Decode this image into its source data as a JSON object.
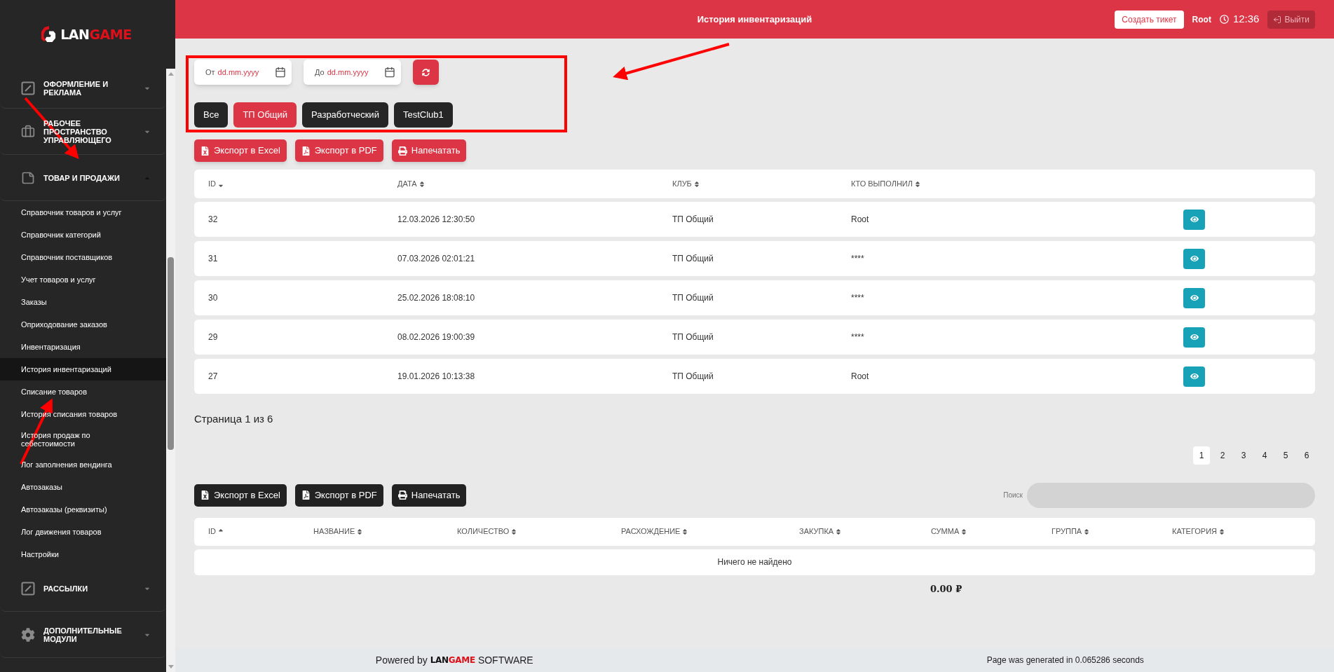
{
  "sidebar": {
    "logo": {
      "light": "LAN",
      "accent": "GAME"
    },
    "groups": [
      {
        "label": "ОФОРМЛЕНИЕ И РЕКЛАМА",
        "expanded": false
      },
      {
        "label": "РАБОЧЕЕ ПРОСТРАНСТВО УПРАВЛЯЮЩЕГО",
        "expanded": false
      },
      {
        "label": "ТОВАР И ПРОДАЖИ",
        "expanded": true,
        "children": [
          {
            "label": "Справочник товаров и услуг",
            "selected": false
          },
          {
            "label": "Справочник категорий",
            "selected": false
          },
          {
            "label": "Справочник поставщиков",
            "selected": false
          },
          {
            "label": "Учет товаров и услуг",
            "selected": false
          },
          {
            "label": "Заказы",
            "selected": false
          },
          {
            "label": "Оприходование заказов",
            "selected": false
          },
          {
            "label": "Инвентаризация",
            "selected": false
          },
          {
            "label": "История инвентаризаций",
            "selected": true
          },
          {
            "label": "Списание товаров",
            "selected": false
          },
          {
            "label": "История списания товаров",
            "selected": false
          },
          {
            "label": "История продаж по себестоимости",
            "selected": false
          },
          {
            "label": "Лог заполнения вендинга",
            "selected": false
          },
          {
            "label": "Автозаказы",
            "selected": false
          },
          {
            "label": "Автозаказы (реквизиты)",
            "selected": false
          },
          {
            "label": "Лог движения товаров",
            "selected": false
          },
          {
            "label": "Настройки",
            "selected": false
          }
        ]
      },
      {
        "label": "РАССЫЛКИ",
        "expanded": false
      },
      {
        "label": "ДОПОЛНИТЕЛЬНЫЕ МОДУЛИ",
        "expanded": false
      }
    ]
  },
  "header": {
    "title": "История инвентаризаций",
    "ticket_button": "Создать тикет",
    "user": "Root",
    "time": "12:36",
    "logout_button": "Выйти"
  },
  "filters": {
    "date_from": {
      "label": "От",
      "placeholder": "dd.mm.yyyy"
    },
    "date_to": {
      "label": "До",
      "placeholder": "dd.mm.yyyy"
    },
    "clubs": [
      {
        "label": "Все",
        "selected": false
      },
      {
        "label": "ТП Общий",
        "selected": true
      },
      {
        "label": "Разработческий",
        "selected": false
      },
      {
        "label": "TestClub1",
        "selected": false
      }
    ]
  },
  "export_buttons": [
    {
      "label": "Экспорт в Excel",
      "kind": "excel"
    },
    {
      "label": "Экспорт в PDF",
      "kind": "pdf"
    },
    {
      "label": "Напечатать",
      "kind": "print"
    }
  ],
  "history_table": {
    "sort_ascending": false,
    "columns": [
      {
        "label": "ID",
        "sorted": true
      },
      {
        "label": "ДАТА",
        "sorted": false
      },
      {
        "label": "КЛУБ",
        "sorted": false
      },
      {
        "label": "КТО ВЫПОЛНИЛ",
        "sorted": false
      }
    ],
    "rows": [
      [
        "32",
        "12.03.2026 12:30:50",
        "ТП Общий",
        "Root"
      ],
      [
        "31",
        "07.03.2026 02:01:21",
        "ТП Общий",
        "****"
      ],
      [
        "30",
        "25.02.2026 18:08:10",
        "ТП Общий",
        "****"
      ],
      [
        "29",
        "08.02.2026 19:00:39",
        "ТП Общий",
        "****"
      ],
      [
        "27",
        "19.01.2026 10:13:38",
        "ТП Общий",
        "Root"
      ]
    ]
  },
  "pagination": {
    "summary": "Страница 1 из 6",
    "pages": [
      {
        "label": "1",
        "selected": true
      },
      {
        "label": "2",
        "selected": false
      },
      {
        "label": "3",
        "selected": false
      },
      {
        "label": "4",
        "selected": false
      },
      {
        "label": "5",
        "selected": false
      },
      {
        "label": "6",
        "selected": false
      }
    ]
  },
  "details": {
    "export_buttons": [
      {
        "label": "Экспорт в Excel",
        "kind": "excel"
      },
      {
        "label": "Экспорт в PDF",
        "kind": "pdf"
      },
      {
        "label": "Напечатать",
        "kind": "print"
      }
    ],
    "search": {
      "label": "Поиск"
    },
    "table": {
      "sort_ascending": true,
      "columns": [
        {
          "label": "ID",
          "sorted": true
        },
        {
          "label": "НАЗВАНИЕ",
          "sorted": false
        },
        {
          "label": "КОЛИЧЕСТВО",
          "sorted": false
        },
        {
          "label": "РАСХОЖДЕНИЕ",
          "sorted": false
        },
        {
          "label": "ЗАКУПКА",
          "sorted": false
        },
        {
          "label": "СУММА",
          "sorted": false
        },
        {
          "label": "ГРУППА",
          "sorted": false
        },
        {
          "label": "КАТЕГОРИЯ",
          "sorted": false
        }
      ],
      "empty_message": "Ничего не найдено"
    },
    "total": "0.00 ₽"
  },
  "footer": {
    "prefix": "Powered by",
    "logo": {
      "dark": "LAN",
      "accent": "GAME"
    },
    "suffix": "SOFTWARE",
    "generated": "Page was generated in 0.065286 seconds"
  }
}
